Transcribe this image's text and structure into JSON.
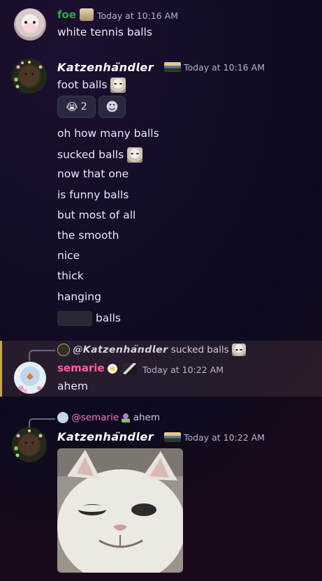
{
  "messages": [
    {
      "author": "foe",
      "time": "Today at 10:16 AM",
      "lines": [
        "white tennis balls"
      ]
    },
    {
      "author": "𝙆𝙖𝙩𝙯𝙚𝙣𝙝𝙖̈𝙣𝙙𝙡𝙚𝙧",
      "time": "Today at 10:16 AM",
      "first_line": "foot balls",
      "reactions": [
        {
          "emoji": "😭",
          "count": "2"
        },
        {
          "emoji": "☻",
          "count": ""
        }
      ],
      "lines": [
        "oh how many balls",
        "sucked balls",
        "now that one",
        "is funny balls",
        "but most of all",
        "the smooth",
        "nice",
        "thick",
        "hanging"
      ],
      "last_line_suffix": "balls"
    },
    {
      "reply_to": "@𝙆𝙖𝙩𝙯𝙚𝙣𝙝𝙖̈𝙣𝙙𝙡𝙚𝙧",
      "reply_text": "sucked balls",
      "author": "semarie",
      "time": "Today at 10:22 AM",
      "lines": [
        "ahem"
      ]
    },
    {
      "reply_to": "@semarie",
      "reply_text": "ahem",
      "author": "𝙆𝙖𝙩𝙯𝙚𝙣𝙝𝙖̈𝙣𝙙𝙡𝙚𝙧",
      "time": "Today at 10:22 AM"
    }
  ],
  "colors": {
    "foe_name": "#3aa24a",
    "semarie_name": "#ff5fa2",
    "mention": "#ff7ab8",
    "highlight_bar": "#c9a24a"
  }
}
